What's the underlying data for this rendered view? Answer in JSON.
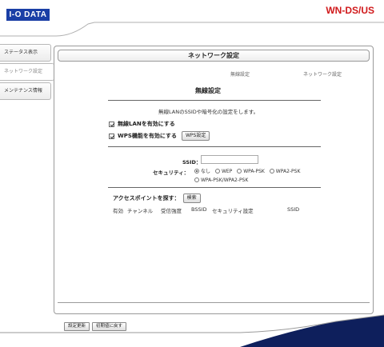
{
  "header": {
    "logo_text": "I-O DATA",
    "model": "WN-DS/US"
  },
  "sidebar": {
    "items": [
      {
        "label": "ステータス表示"
      },
      {
        "label": "ネットワーク設定"
      },
      {
        "label": "メンテナンス情報"
      }
    ]
  },
  "main": {
    "panel_title": "ネットワーク設定",
    "breadcrumb": [
      "無線設定",
      "ネットワーク設定"
    ],
    "section_title": "無線設定",
    "description": "無線LANのSSIDや暗号化の設定をします。",
    "enable_wireless_label": "無線LANを有効にする",
    "enable_wps_label": "WPS機能を有効にする",
    "wps_button": "WPS設定",
    "ssid_label": "SSID：",
    "ssid_value": "",
    "security_label": "セキュリティ：",
    "security_options": [
      "なし",
      "WEP",
      "WPA-PSK",
      "WPA2-PSK",
      "WPA-PSK/WPA2-PSK"
    ],
    "security_selected": "なし",
    "find_ap_label": "アクセスポイントを探す：",
    "search_button": "検索",
    "ap_columns": [
      "有効",
      "チャンネル",
      "受信強度",
      "BSSID",
      "セキュリティ設定",
      "SSID"
    ]
  },
  "footer": {
    "apply_button": "設定更新",
    "reset_button": "初期値に戻す"
  },
  "colors": {
    "logo_bg": "#1a3fa6",
    "model_text": "#d0191b",
    "footer_wave": "#0e1f5c"
  }
}
